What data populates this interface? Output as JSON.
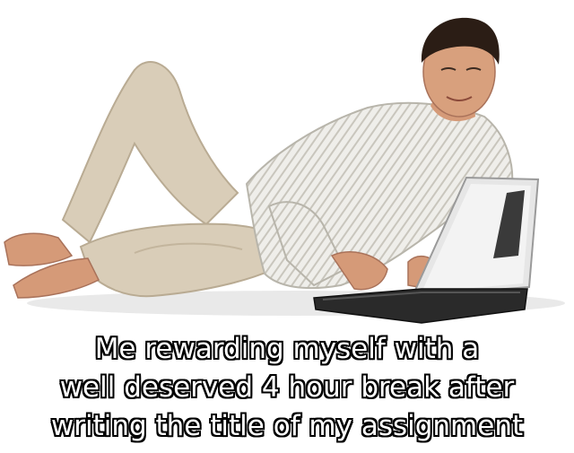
{
  "meme": {
    "caption_lines": [
      "Me rewarding myself with a",
      "well deserved 4 hour break after",
      "writing the title of my assignment"
    ]
  },
  "colors": {
    "background": "#ffffff",
    "caption_fill": "#ffffff",
    "caption_outline": "#000000",
    "pants": "#d9cdb8",
    "shirt": "#ecebe6",
    "skin": "#d59a78",
    "hair": "#2b1d15",
    "laptop_body": "#e6e6e6",
    "laptop_base": "#2a2a2a"
  }
}
